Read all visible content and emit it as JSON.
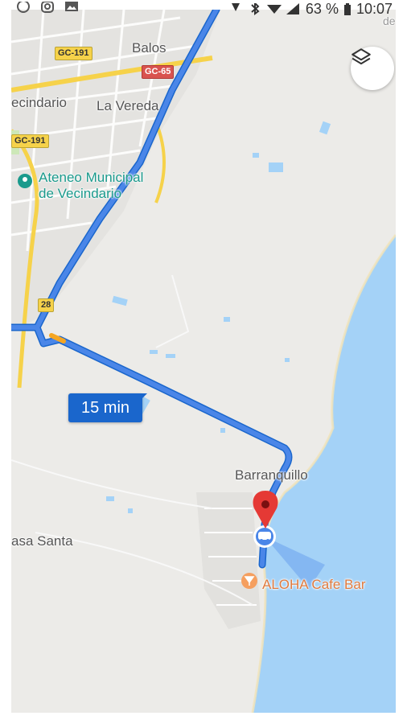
{
  "status_bar": {
    "battery": "63 %",
    "time": "10:07"
  },
  "map": {
    "towns": {
      "balos": "Balos",
      "vecindario": "ecindario",
      "la_vereda": "La Vereda",
      "barranquillo": "Barranquillo",
      "casa_santa": "asa Santa",
      "corner_text": "de"
    },
    "road_shields": {
      "gc191_top": "GC-191",
      "gc65": "GC-65",
      "gc191_left": "GC-191",
      "r28": "28"
    },
    "poi": {
      "ateneo_line1": "Ateneo Municipal",
      "ateneo_line2": "de Vecindario",
      "cafe": "ALOHA Cafe Bar"
    },
    "route": {
      "eta": "15 min",
      "color": "#4a86e8"
    },
    "colors": {
      "land": "#ecebe8",
      "water": "#a4d2f7",
      "pin": "#e53935",
      "road_yellow": "#f6d24a"
    }
  },
  "controls": {
    "layers_icon": "layers-icon"
  }
}
